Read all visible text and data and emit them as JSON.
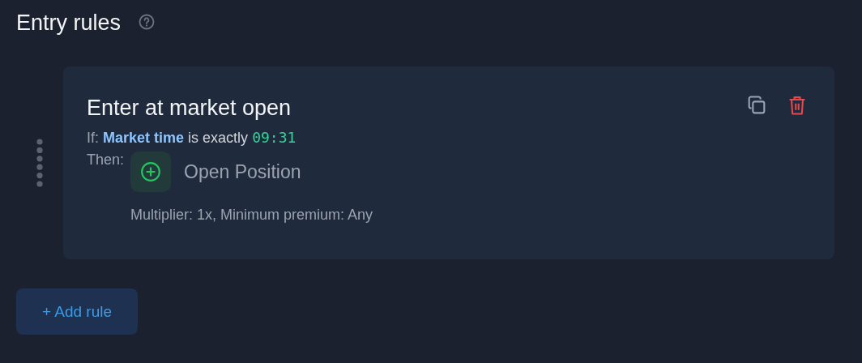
{
  "section": {
    "title": "Entry rules"
  },
  "rules": [
    {
      "name": "Enter at market open",
      "condition": {
        "prefix": "If:",
        "field": "Market time",
        "operator": "is exactly",
        "value": "09:31"
      },
      "then_label": "Then:",
      "action": {
        "kind": "open",
        "label": "Open Position",
        "details": "Multiplier: 1x, Minimum premium: Any"
      }
    }
  ],
  "add_button": "+ Add rule"
}
